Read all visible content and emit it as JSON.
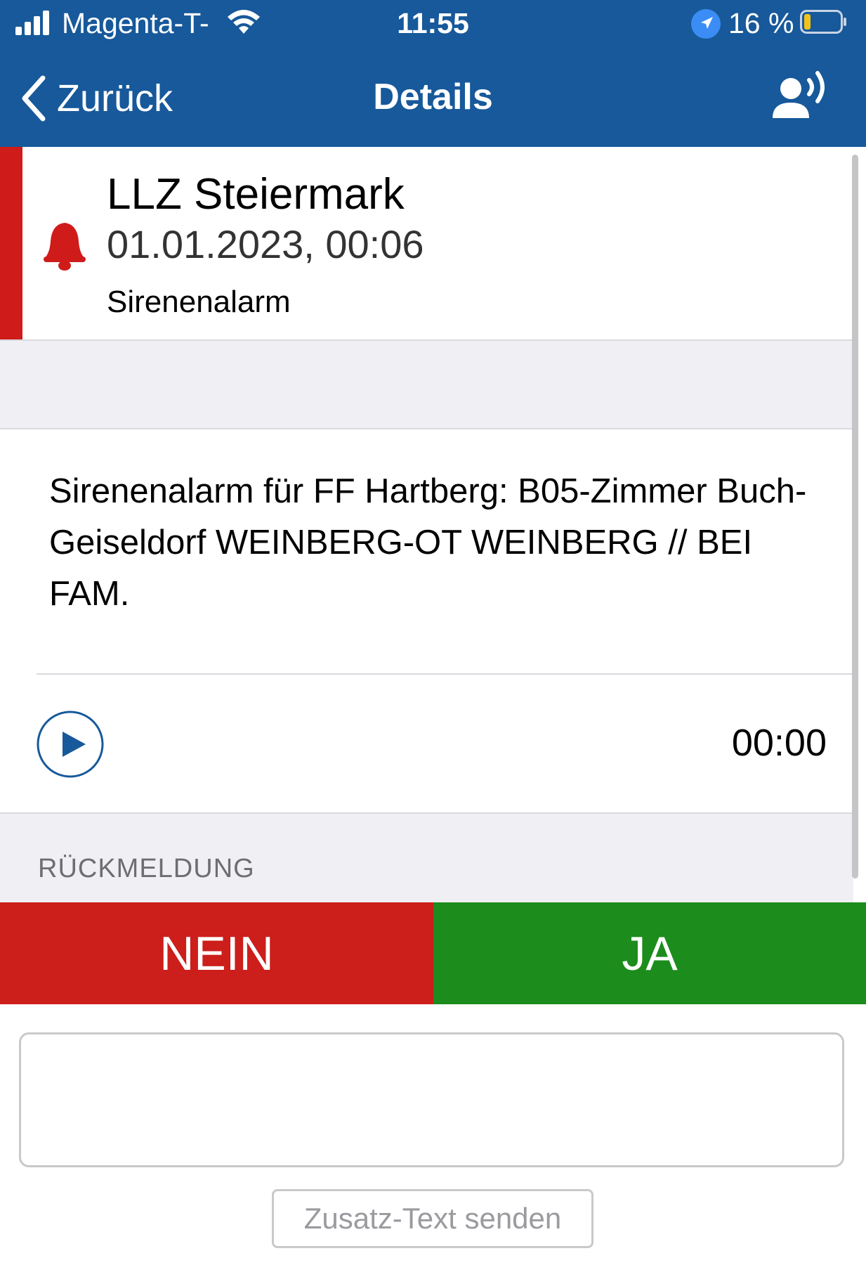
{
  "status_bar": {
    "carrier": "Magenta-T-",
    "time": "11:55",
    "battery_text": "16 %",
    "battery_level": 0.16
  },
  "navbar": {
    "back_label": "Zurück",
    "title": "Details"
  },
  "alert": {
    "title": "LLZ Steiermark",
    "datetime": "01.01.2023, 00:06",
    "type": "Sirenenalarm"
  },
  "message": {
    "text": "Sirenenalarm für FF Hartberg: B05-Zimmer Buch-Geiseldorf WEINBERG-OT WEINBERG        // BEI FAM."
  },
  "audio": {
    "duration": "00:00"
  },
  "feedback": {
    "label": "RÜCKMELDUNG",
    "no_label": "NEIN",
    "yes_label": "JA"
  },
  "extra_text": {
    "value": "",
    "send_label": "Zusatz-Text senden"
  },
  "colors": {
    "header": "#17599a",
    "alert_red": "#cf1c1a",
    "no_button": "#cc1e1b",
    "yes_button": "#1c8c1c",
    "location_blue": "#3b8df5",
    "battery_low": "#f2c21b"
  }
}
